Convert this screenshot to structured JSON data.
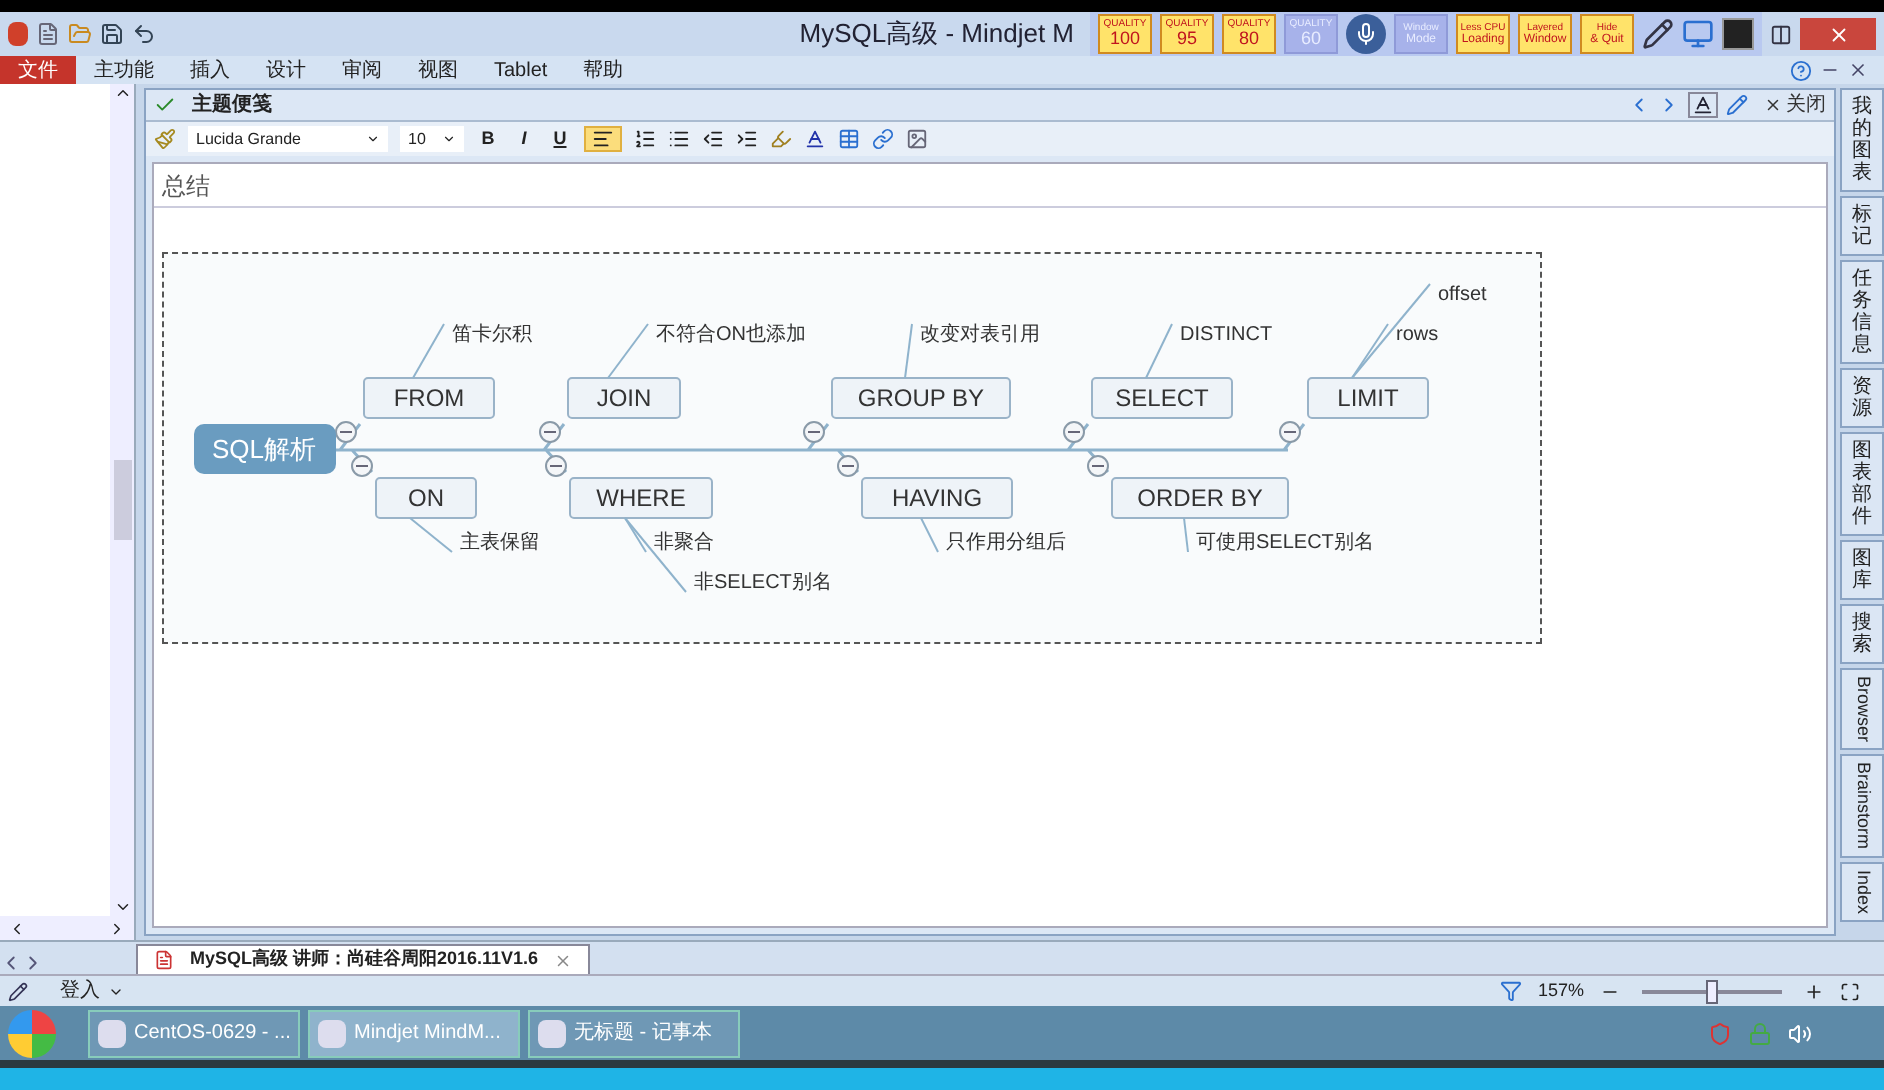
{
  "title_bar": {
    "title": "MySQL高级 - Mindjet M"
  },
  "recorder_toolbar": [
    {
      "kind": "quality",
      "caption": "QUALITY",
      "label": "100",
      "disabled": false
    },
    {
      "kind": "quality",
      "caption": "QUALITY",
      "label": "95",
      "disabled": false
    },
    {
      "kind": "quality",
      "caption": "QUALITY",
      "label": "80",
      "disabled": false
    },
    {
      "kind": "quality",
      "caption": "QUALITY",
      "label": "60",
      "disabled": true
    },
    {
      "kind": "text",
      "caption": "Window",
      "label": "Mode",
      "disabled": true
    },
    {
      "kind": "text",
      "caption": "Less CPU",
      "label": "Loading",
      "disabled": false
    },
    {
      "kind": "text",
      "caption": "Layered",
      "label": "Window",
      "disabled": false
    },
    {
      "kind": "text",
      "caption": "Hide",
      "label": "& Quit",
      "disabled": false
    }
  ],
  "ribbon": {
    "file_tab": "文件",
    "tabs": [
      "主功能",
      "插入",
      "设计",
      "审阅",
      "视图",
      "Tablet",
      "帮助"
    ]
  },
  "notes_panel": {
    "title": "主题便笺",
    "close": "关闭",
    "font": "Lucida Grande",
    "size": "10",
    "format_buttons": [
      "B",
      "I",
      "U"
    ],
    "align_selected": true,
    "text": "总结"
  },
  "mind_map": {
    "root": "SQL解析",
    "topics": [
      {
        "label": "FROM",
        "notes": [
          "笛卡尔积"
        ]
      },
      {
        "label": "ON",
        "notes": [
          "主表保留"
        ]
      },
      {
        "label": "JOIN",
        "notes": [
          "不符合ON也添加"
        ]
      },
      {
        "label": "WHERE",
        "notes": [
          "非聚合",
          "非SELECT别名"
        ]
      },
      {
        "label": "GROUP BY",
        "notes": [
          "改变对表引用"
        ]
      },
      {
        "label": "HAVING",
        "notes": [
          "只作用分组后"
        ]
      },
      {
        "label": "SELECT",
        "notes": [
          "DISTINCT"
        ]
      },
      {
        "label": "ORDER BY",
        "notes": [
          "可使用SELECT别名"
        ]
      },
      {
        "label": "LIMIT",
        "notes": [
          "rows",
          "offset"
        ]
      }
    ]
  },
  "side_tabs": [
    {
      "kind": "cjk",
      "label": "我的图表"
    },
    {
      "kind": "cjk",
      "label": "标记"
    },
    {
      "kind": "cjk",
      "label": "任务信息"
    },
    {
      "kind": "cjk",
      "label": "资源"
    },
    {
      "kind": "cjk",
      "label": "图表部件"
    },
    {
      "kind": "cjk",
      "label": "图库"
    },
    {
      "kind": "cjk",
      "label": "搜索"
    },
    {
      "kind": "latin",
      "label": "Browser"
    },
    {
      "kind": "latin",
      "label": "Brainstorm"
    },
    {
      "kind": "latin",
      "label": "Index"
    }
  ],
  "doc_tab": {
    "label": "MySQL高级 讲师：尚硅谷周阳2016.11V1.6"
  },
  "status_bar": {
    "login": "登入",
    "zoom": "157%",
    "level": 0.5
  },
  "taskbar": [
    {
      "label": "CentOS-0629 - ...",
      "selected": false
    },
    {
      "label": "Mindjet MindM...",
      "selected": true
    },
    {
      "label": "无标题 - 记事本",
      "selected": false
    }
  ]
}
